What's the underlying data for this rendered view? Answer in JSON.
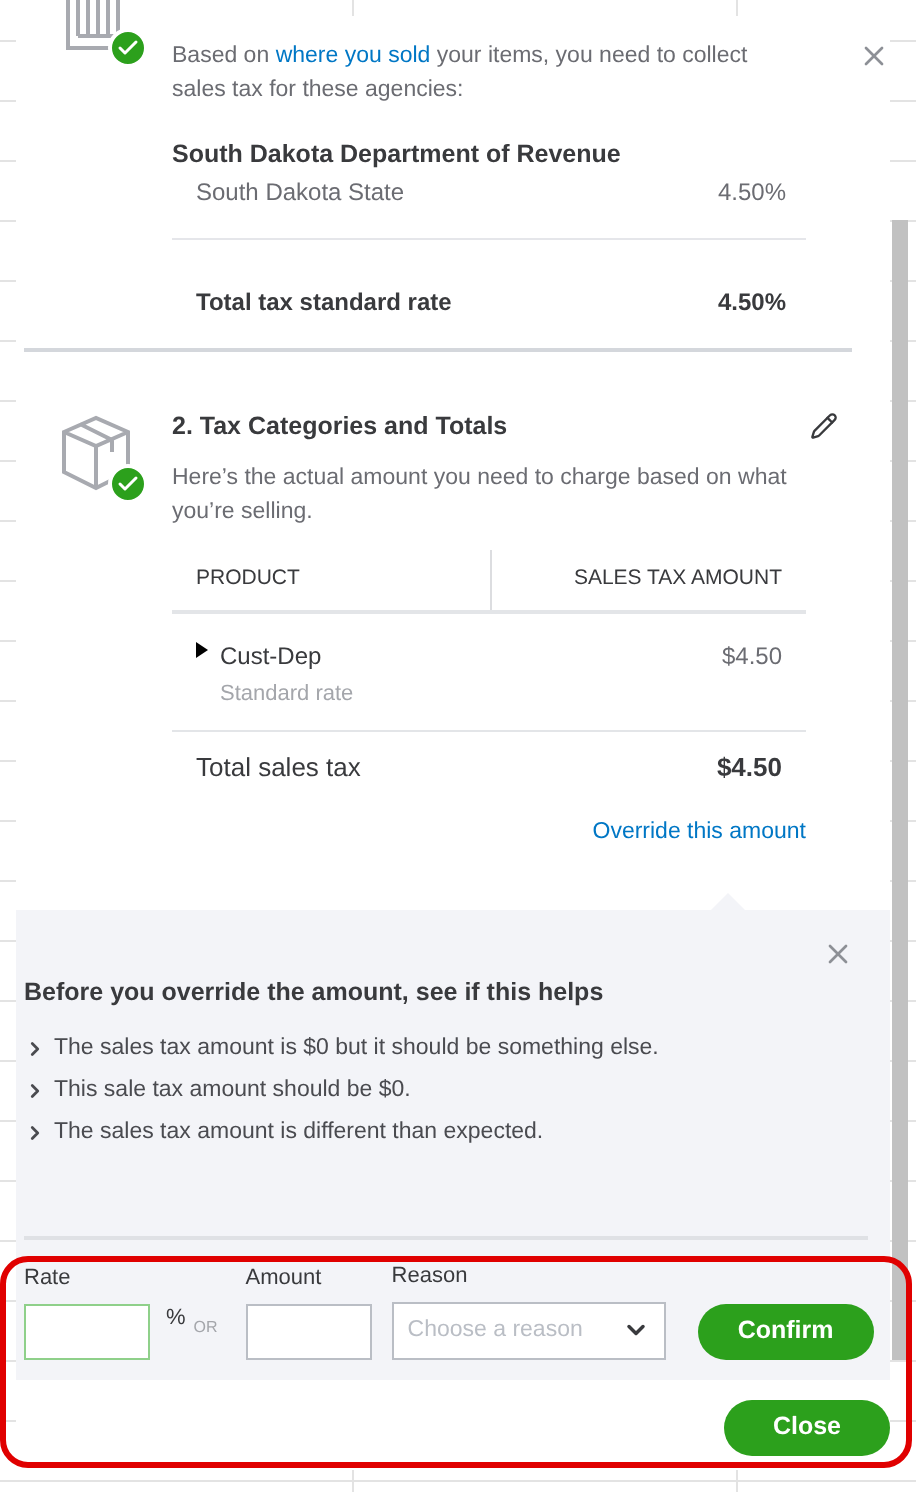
{
  "agencies": {
    "text_before": "Based on",
    "link": "where you sold",
    "text_after": "your items, you need to collect sales tax for these agencies:",
    "agency": "South Dakota Department of Revenue",
    "rates": [
      {
        "name": "South Dakota State",
        "rate": "4.50%"
      }
    ],
    "total": {
      "label": "Total tax standard rate",
      "value": "4.50%"
    }
  },
  "categories": {
    "title": "2. Tax Categories and Totals",
    "description": "Here’s the actual amount you need to charge based on what you’re selling.",
    "table": {
      "columns": [
        "PRODUCT",
        "SALES TAX AMOUNT"
      ],
      "rows": [
        {
          "product": "Cust-Dep",
          "detail": "Standard rate",
          "amount": "$4.50",
          "expanded": false
        }
      ],
      "total": {
        "label": "Total sales tax",
        "value": "$4.50"
      }
    },
    "override_link": "Override this amount"
  },
  "override": {
    "heading": "Before you override the amount, see if this helps",
    "tips": [
      "The sales tax amount is $0 but it should be something else.",
      "This sale tax amount should be $0.",
      "The sales tax amount is different than expected."
    ],
    "rate": {
      "label": "Rate",
      "unit": "%",
      "or": "OR"
    },
    "amount": {
      "label": "Amount"
    },
    "reason": {
      "label": "Reason",
      "placeholder": "Choose a reason"
    },
    "confirm": "Confirm"
  },
  "close": "Close"
}
